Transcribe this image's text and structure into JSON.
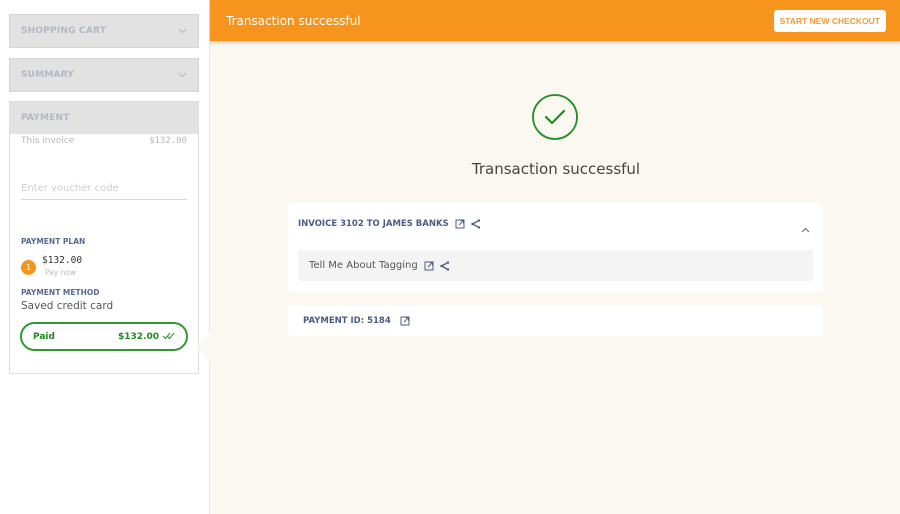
{
  "sidebar": {
    "sections": [
      {
        "title": "SHOPPING CART",
        "icon": "chevron-down-icon"
      },
      {
        "title": "SUMMARY",
        "icon": "chevron-down-icon"
      },
      {
        "title": "PAYMENT"
      }
    ],
    "payment": {
      "invoice_label": "This invoice",
      "invoice_amount": "$132.00",
      "voucher_placeholder": "Enter voucher code",
      "plan_label": "PAYMENT PLAN",
      "plan_step": "1",
      "plan_amount": "$132.00",
      "plan_sub": "Pay now",
      "method_label": "PAYMENT METHOD",
      "method_value": "Saved credit card",
      "status_label": "Paid",
      "status_amount": "$132.00",
      "status_icon": "double-check-icon"
    }
  },
  "topbar": {
    "title": "Transaction successful",
    "button": "START NEW CHECKOUT"
  },
  "main": {
    "status_icon": "check-circle-icon",
    "title": "Transaction successful",
    "invoice_card": {
      "title": "INVOICE 3102 TO JAMES BANKS",
      "items": [
        {
          "title": "Tell Me About Tagging"
        }
      ]
    },
    "payment_card": {
      "title": "PAYMENT ID: 5184"
    }
  },
  "colors": {
    "accent": "#f7941d",
    "success": "#2e9a2e",
    "label": "#4d5c80",
    "background": "#fbf8f1"
  }
}
